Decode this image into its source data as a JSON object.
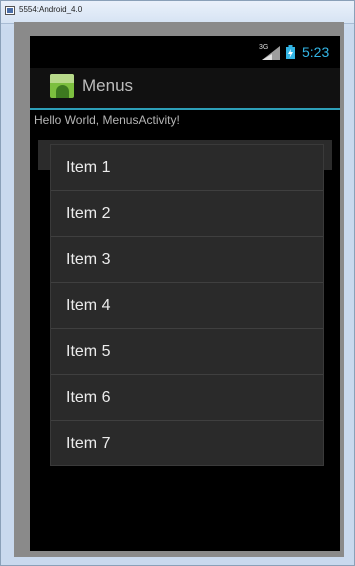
{
  "window": {
    "title": "5554:Android_4.0"
  },
  "status_bar": {
    "network": "3G",
    "signal_icon": "cell-signal-icon",
    "battery_icon": "battery-charging-icon",
    "time": "5:23",
    "accent_color": "#33b5e5"
  },
  "action_bar": {
    "app_icon": "android-app-icon",
    "title": "Menus",
    "divider_color": "#2d9fb8"
  },
  "content": {
    "text": "Hello World, MenusActivity!"
  },
  "menu": {
    "items": [
      {
        "label": "Item 1"
      },
      {
        "label": "Item 2"
      },
      {
        "label": "Item 3"
      },
      {
        "label": "Item 4"
      },
      {
        "label": "Item 5"
      },
      {
        "label": "Item 6"
      },
      {
        "label": "Item 7"
      }
    ]
  }
}
